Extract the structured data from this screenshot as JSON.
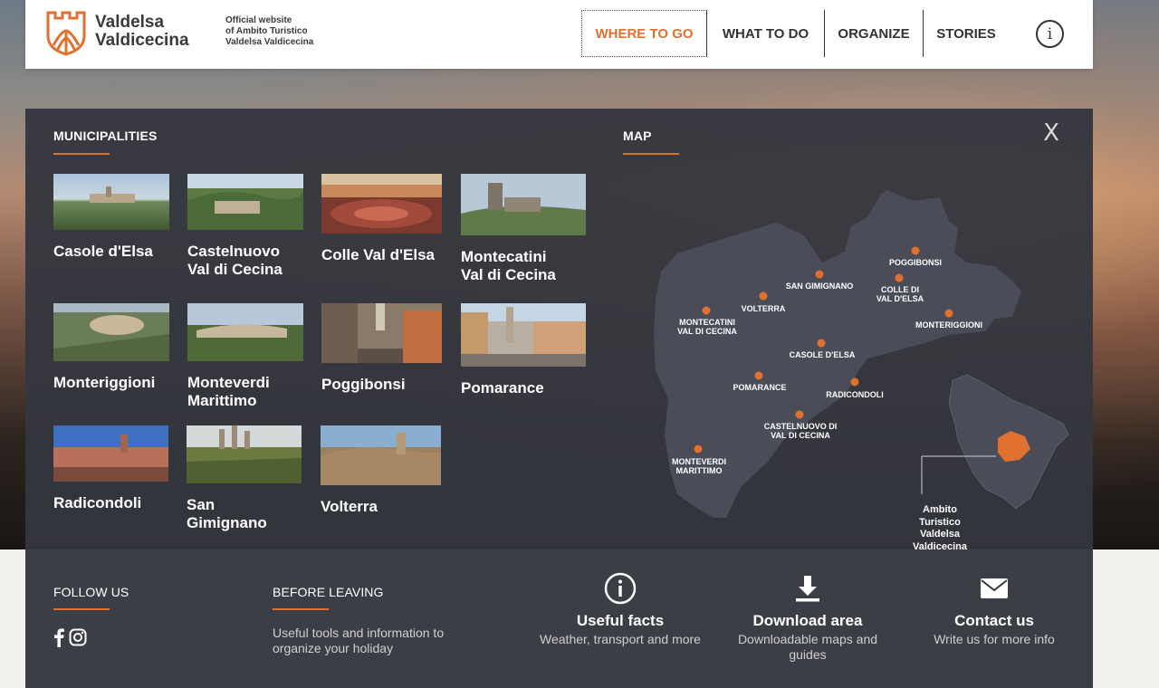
{
  "header": {
    "logo_line1": "Valdelsa",
    "logo_line2": "Valdicecina",
    "subtitle_line1": "Official website",
    "subtitle_line2": "of Ambito Turistico",
    "subtitle_line3": "Valdelsa Valdicecina",
    "nav": [
      {
        "label": "WHERE TO GO",
        "active": true
      },
      {
        "label": "WHAT TO DO",
        "active": false
      },
      {
        "label": "ORGANIZE",
        "active": false
      },
      {
        "label": "STORIES",
        "active": false
      }
    ],
    "info_icon": "info-icon"
  },
  "panel": {
    "municipalities_title": "MUNICIPALITIES",
    "map_title": "MAP",
    "close_label": "X",
    "municipalities": [
      {
        "name": "Casole d'Elsa"
      },
      {
        "name": "Castelnuovo\nVal di Cecina"
      },
      {
        "name": "Colle Val d'Elsa"
      },
      {
        "name": "Montecatini\nVal di Cecina"
      },
      {
        "name": "Monteriggioni"
      },
      {
        "name": "Monteverdi\nMarittimo"
      },
      {
        "name": "Poggibonsi"
      },
      {
        "name": "Pomarance"
      },
      {
        "name": "Radicondoli"
      },
      {
        "name": "San\nGimignano"
      },
      {
        "name": "Volterra"
      }
    ],
    "map": {
      "labels": [
        {
          "text": "POGGIBONSI"
        },
        {
          "text": "SAN GIMIGNANO"
        },
        {
          "text": "COLLE DI\nVAL D'ELSA"
        },
        {
          "text": "VOLTERRA"
        },
        {
          "text": "MONTECATINI\nVAL DI CECINA"
        },
        {
          "text": "MONTERIGGIONI"
        },
        {
          "text": "CASOLE D'ELSA"
        },
        {
          "text": "POMARANCE"
        },
        {
          "text": "RADICONDOLI"
        },
        {
          "text": "CASTELNUOVO DI\nVAL DI CECINA"
        },
        {
          "text": "MONTEVERDI\nMARITTIMO"
        }
      ],
      "ambito_label": "Ambito\nTuristico\nValdelsa\nValdicecina"
    },
    "follow_us": "FOLLOW US",
    "before_leaving": "BEFORE LEAVING",
    "before_leaving_text": "Useful tools and information to organize your holiday",
    "features": [
      {
        "title": "Useful facts",
        "subtitle": "Weather, transport and more",
        "icon": "info-icon"
      },
      {
        "title": "Download area",
        "subtitle": "Downloadable maps and guides",
        "icon": "download-icon"
      },
      {
        "title": "Contact us",
        "subtitle": "Write us for more info",
        "icon": "mail-icon"
      }
    ]
  },
  "colors": {
    "accent": "#e07030",
    "panel_bg": "#34363e",
    "map_fill": "#4a4d57"
  }
}
